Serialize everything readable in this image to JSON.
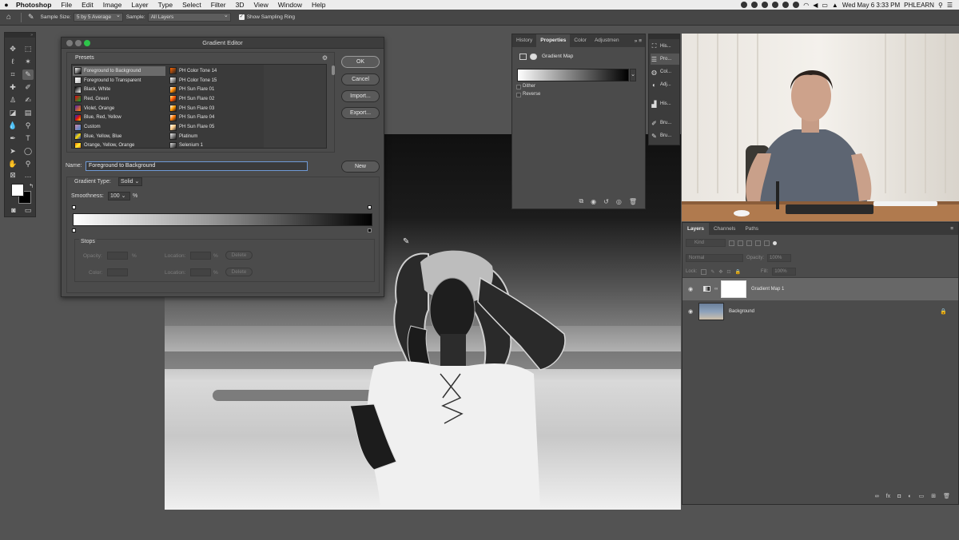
{
  "menubar": {
    "app_name": "Photoshop",
    "menus": [
      "File",
      "Edit",
      "Image",
      "Layer",
      "Type",
      "Select",
      "Filter",
      "3D",
      "View",
      "Window",
      "Help"
    ],
    "clock": "Wed May 6  3:33 PM",
    "user": "PHLEARN"
  },
  "options_bar": {
    "sample_size_label": "Sample Size:",
    "sample_size_value": "5 by 5 Average",
    "sample_label": "Sample:",
    "sample_value": "All Layers",
    "show_sampling_ring_label": "Show Sampling Ring",
    "show_sampling_ring_checked": true
  },
  "gradient_editor": {
    "title": "Gradient Editor",
    "presets_label": "Presets",
    "buttons": {
      "ok": "OK",
      "cancel": "Cancel",
      "import": "Import...",
      "export": "Export...",
      "new": "New"
    },
    "presets_col1": [
      {
        "label": "Foreground to Background",
        "selected": true
      },
      {
        "label": "Foreground to Transparent"
      },
      {
        "label": "Black, White"
      },
      {
        "label": "Red, Green"
      },
      {
        "label": "Violet, Orange"
      },
      {
        "label": "Blue, Red, Yellow"
      },
      {
        "label": "Custom"
      },
      {
        "label": "Blue, Yellow, Blue"
      },
      {
        "label": "Orange, Yellow, Orange"
      }
    ],
    "presets_col2": [
      {
        "label": "PH Color Tone 14"
      },
      {
        "label": "PH Color Tone 15"
      },
      {
        "label": "PH Sun Flare 01"
      },
      {
        "label": "PH Sun Flare 02"
      },
      {
        "label": "PH Sun Flare 03"
      },
      {
        "label": "PH Sun Flare 04"
      },
      {
        "label": "PH Sun Flare 05"
      },
      {
        "label": "Platinum"
      },
      {
        "label": "Selenium 1"
      }
    ],
    "name_label": "Name:",
    "name_value": "Foreground to Background",
    "gradient_type_label": "Gradient Type:",
    "gradient_type_value": "Solid",
    "smoothness_label": "Smoothness:",
    "smoothness_value": "100",
    "smoothness_unit": "%",
    "stops_label": "Stops",
    "opacity_label": "Opacity:",
    "color_label": "Color:",
    "location_label": "Location:",
    "percent": "%",
    "delete_label": "Delete"
  },
  "properties_panel": {
    "tabs": [
      "History",
      "Properties",
      "Color",
      "Adjustmen"
    ],
    "active_tab": "Properties",
    "title": "Gradient Map",
    "dither_label": "Dither",
    "reverse_label": "Reverse"
  },
  "collapsed_panels": [
    "His...",
    "Pro...",
    "Col...",
    "Adj...",
    "His...",
    "Bru...",
    "Bru..."
  ],
  "layers_panel": {
    "tabs": [
      "Layers",
      "Channels",
      "Paths"
    ],
    "active_tab": "Layers",
    "kind_placeholder": "Kind",
    "blend_mode": "Normal",
    "opacity_label": "Opacity:",
    "opacity_value": "100%",
    "lock_label": "Lock:",
    "fill_label": "Fill:",
    "fill_value": "100%",
    "layers": [
      {
        "name": "Gradient Map 1",
        "selected": true
      },
      {
        "name": "Background",
        "locked": true
      }
    ]
  },
  "colors": {
    "ui_bg": "#535353",
    "panel": "#4b4b4b",
    "selection": "#676767",
    "focus_ring": "#6f9ad6"
  }
}
